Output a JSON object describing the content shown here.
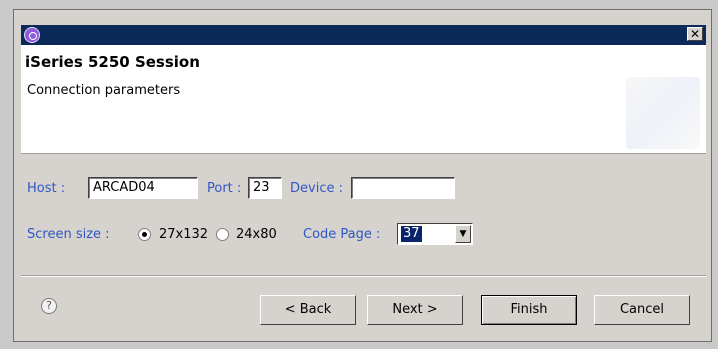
{
  "window": {
    "title_text": "",
    "close_label": "✕"
  },
  "header": {
    "title": "iSeries 5250 Session",
    "subtitle": "Connection parameters"
  },
  "form": {
    "host_label": "Host :",
    "host_value": "ARCAD04",
    "port_label": "Port :",
    "port_value": "23",
    "device_label": "Device :",
    "device_value": "",
    "screen_size_label": "Screen size :",
    "screen_options": [
      {
        "label": "27x132",
        "selected": true
      },
      {
        "label": "24x80",
        "selected": false
      }
    ],
    "code_page_label": "Code Page :",
    "code_page_value": "37"
  },
  "footer": {
    "help_glyph": "?",
    "back_label": "< Back",
    "next_label": "Next >",
    "finish_label": "Finish",
    "cancel_label": "Cancel"
  },
  "colors": {
    "titlebar": "#0b2a5a",
    "label_blue": "#2f56c7",
    "dialog_bg": "#d6d3ce"
  }
}
